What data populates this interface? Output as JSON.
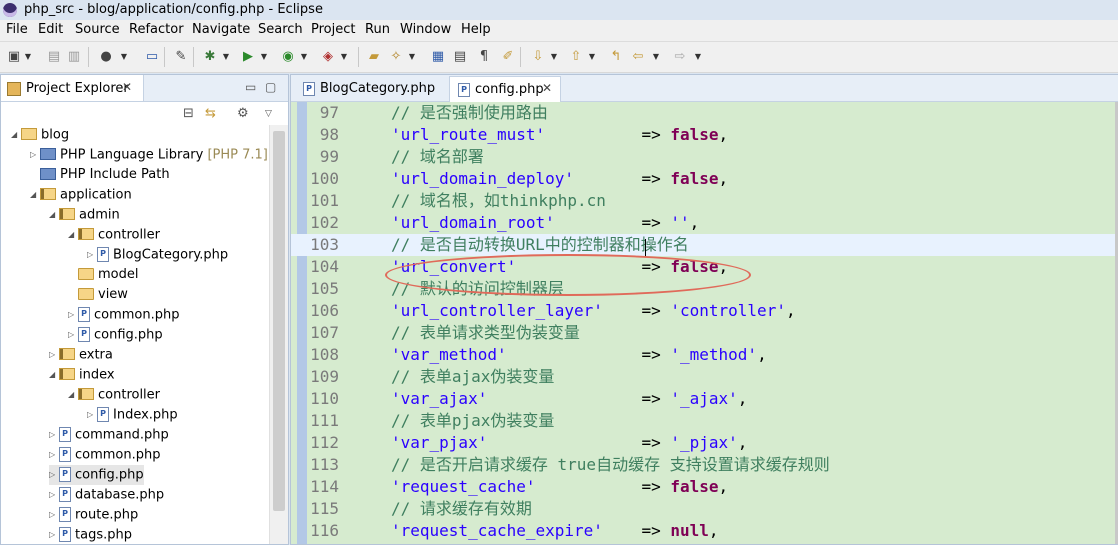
{
  "window": {
    "title": "php_src - blog/application/config.php - Eclipse"
  },
  "menu": [
    "File",
    "Edit",
    "Source",
    "Refactor",
    "Navigate",
    "Search",
    "Project",
    "Run",
    "Window",
    "Help"
  ],
  "explorer": {
    "title": "Project Explorer",
    "tree": [
      {
        "label": "blog",
        "kind": "proj",
        "arrow": "◢",
        "indent": 0
      },
      {
        "label": "PHP Language Library",
        "extra": "[PHP 7.1]",
        "kind": "lib",
        "arrow": "▷",
        "indent": 1
      },
      {
        "label": "PHP Include Path",
        "kind": "lib",
        "arrow": "",
        "indent": 1
      },
      {
        "label": "application",
        "kind": "pkg",
        "arrow": "◢",
        "indent": 1
      },
      {
        "label": "admin",
        "kind": "pkg",
        "arrow": "◢",
        "indent": 2
      },
      {
        "label": "controller",
        "kind": "pkg",
        "arrow": "◢",
        "indent": 3
      },
      {
        "label": "BlogCategory.php",
        "kind": "file",
        "arrow": "▷",
        "indent": 4
      },
      {
        "label": "model",
        "kind": "folder",
        "arrow": "",
        "indent": 3
      },
      {
        "label": "view",
        "kind": "folder",
        "arrow": "",
        "indent": 3
      },
      {
        "label": "common.php",
        "kind": "file",
        "arrow": "▷",
        "indent": 3
      },
      {
        "label": "config.php",
        "kind": "file",
        "arrow": "▷",
        "indent": 3
      },
      {
        "label": "extra",
        "kind": "pkg",
        "arrow": "▷",
        "indent": 2
      },
      {
        "label": "index",
        "kind": "pkg",
        "arrow": "◢",
        "indent": 2
      },
      {
        "label": "controller",
        "kind": "pkg",
        "arrow": "◢",
        "indent": 3
      },
      {
        "label": "Index.php",
        "kind": "file",
        "arrow": "▷",
        "indent": 4
      },
      {
        "label": "command.php",
        "kind": "file",
        "arrow": "▷",
        "indent": 2
      },
      {
        "label": "common.php",
        "kind": "file",
        "arrow": "▷",
        "indent": 2
      },
      {
        "label": "config.php",
        "kind": "file",
        "arrow": "▷",
        "indent": 2,
        "selected": true
      },
      {
        "label": "database.php",
        "kind": "file",
        "arrow": "▷",
        "indent": 2
      },
      {
        "label": "route.php",
        "kind": "file",
        "arrow": "▷",
        "indent": 2
      },
      {
        "label": "tags.php",
        "kind": "file",
        "arrow": "▷",
        "indent": 2
      }
    ]
  },
  "editor": {
    "tabs": [
      {
        "label": "BlogCategory.php",
        "active": false
      },
      {
        "label": "config.php",
        "active": true
      }
    ],
    "lines": [
      {
        "n": "97",
        "parts": [
          [
            "c",
            "// 是否强制使用路由"
          ]
        ]
      },
      {
        "n": "98",
        "parts": [
          [
            "s",
            "'url_route_must'"
          ],
          [
            "o",
            "          => "
          ],
          [
            "k",
            "false"
          ],
          [
            "o",
            ","
          ]
        ]
      },
      {
        "n": "99",
        "parts": [
          [
            "c",
            "// 域名部署"
          ]
        ]
      },
      {
        "n": "100",
        "parts": [
          [
            "s",
            "'url_domain_deploy'"
          ],
          [
            "o",
            "       => "
          ],
          [
            "k",
            "false"
          ],
          [
            "o",
            ","
          ]
        ]
      },
      {
        "n": "101",
        "parts": [
          [
            "c",
            "// 域名根，如thinkphp.cn"
          ]
        ]
      },
      {
        "n": "102",
        "parts": [
          [
            "s",
            "'url_domain_root'"
          ],
          [
            "o",
            "         => "
          ],
          [
            "s",
            "''"
          ],
          [
            "o",
            ","
          ]
        ]
      },
      {
        "n": "103",
        "parts": [
          [
            "c",
            "// 是否自动转换URL中的控制器和操作名"
          ]
        ],
        "current": true
      },
      {
        "n": "104",
        "parts": [
          [
            "s",
            "'url_convert'"
          ],
          [
            "o",
            "             => "
          ],
          [
            "k",
            "false"
          ],
          [
            "o",
            ","
          ]
        ]
      },
      {
        "n": "105",
        "parts": [
          [
            "c",
            "// 默认的访问控制器层"
          ]
        ]
      },
      {
        "n": "106",
        "parts": [
          [
            "s",
            "'url_controller_layer'"
          ],
          [
            "o",
            "    => "
          ],
          [
            "s",
            "'controller'"
          ],
          [
            "o",
            ","
          ]
        ]
      },
      {
        "n": "107",
        "parts": [
          [
            "c",
            "// 表单请求类型伪装变量"
          ]
        ]
      },
      {
        "n": "108",
        "parts": [
          [
            "s",
            "'var_method'"
          ],
          [
            "o",
            "              => "
          ],
          [
            "s",
            "'_method'"
          ],
          [
            "o",
            ","
          ]
        ]
      },
      {
        "n": "109",
        "parts": [
          [
            "c",
            "// 表单ajax伪装变量"
          ]
        ]
      },
      {
        "n": "110",
        "parts": [
          [
            "s",
            "'var_ajax'"
          ],
          [
            "o",
            "                => "
          ],
          [
            "s",
            "'_ajax'"
          ],
          [
            "o",
            ","
          ]
        ]
      },
      {
        "n": "111",
        "parts": [
          [
            "c",
            "// 表单pjax伪装变量"
          ]
        ]
      },
      {
        "n": "112",
        "parts": [
          [
            "s",
            "'var_pjax'"
          ],
          [
            "o",
            "                => "
          ],
          [
            "s",
            "'_pjax'"
          ],
          [
            "o",
            ","
          ]
        ]
      },
      {
        "n": "113",
        "parts": [
          [
            "c",
            "// 是否开启请求缓存 true自动缓存 支持设置请求缓存规则"
          ]
        ]
      },
      {
        "n": "114",
        "parts": [
          [
            "s",
            "'request_cache'"
          ],
          [
            "o",
            "           => "
          ],
          [
            "k",
            "false"
          ],
          [
            "o",
            ","
          ]
        ]
      },
      {
        "n": "115",
        "parts": [
          [
            "c",
            "// 请求缓存有效期"
          ]
        ]
      },
      {
        "n": "116",
        "parts": [
          [
            "s",
            "'request_cache_expire'"
          ],
          [
            "o",
            "    => "
          ],
          [
            "k",
            "null"
          ],
          [
            "o",
            ","
          ]
        ]
      }
    ]
  }
}
